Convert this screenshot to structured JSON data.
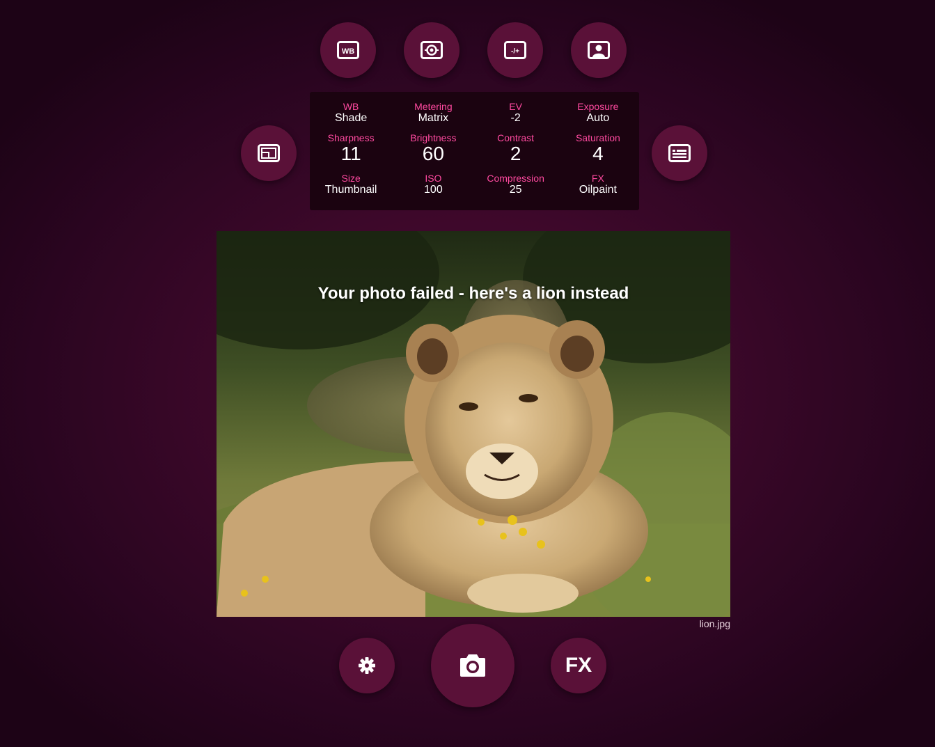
{
  "top_buttons": [
    {
      "icon": "wb-icon",
      "label": "WB"
    },
    {
      "icon": "metering-icon",
      "label": ""
    },
    {
      "icon": "ev-icon",
      "label": "-/+"
    },
    {
      "icon": "exposure-portrait-icon",
      "label": ""
    }
  ],
  "side_buttons": {
    "left_icon": "image-size-icon",
    "right_icon": "list-details-icon"
  },
  "settings": {
    "wb": {
      "label": "WB",
      "value": "Shade"
    },
    "metering": {
      "label": "Metering",
      "value": "Matrix"
    },
    "ev": {
      "label": "EV",
      "value": "-2"
    },
    "exposure": {
      "label": "Exposure",
      "value": "Auto"
    },
    "sharpness": {
      "label": "Sharpness",
      "value": "11"
    },
    "brightness": {
      "label": "Brightness",
      "value": "60"
    },
    "contrast": {
      "label": "Contrast",
      "value": "2"
    },
    "saturation": {
      "label": "Saturation",
      "value": "4"
    },
    "size": {
      "label": "Size",
      "value": "Thumbnail"
    },
    "iso": {
      "label": "ISO",
      "value": "100"
    },
    "compression": {
      "label": "Compression",
      "value": "25"
    },
    "fx": {
      "label": "FX",
      "value": "Oilpaint"
    }
  },
  "photo": {
    "caption": "Your photo failed - here's a lion instead",
    "filename": "lion.jpg"
  },
  "bottom_buttons": {
    "settings_icon": "gear-icon",
    "shutter_icon": "camera-icon",
    "fx_label": "FX"
  },
  "colors": {
    "background": "#3d082a",
    "button": "#5a1138",
    "panel": "#1b0310",
    "label_accent": "#ff4aa0",
    "text": "#ffffff"
  }
}
